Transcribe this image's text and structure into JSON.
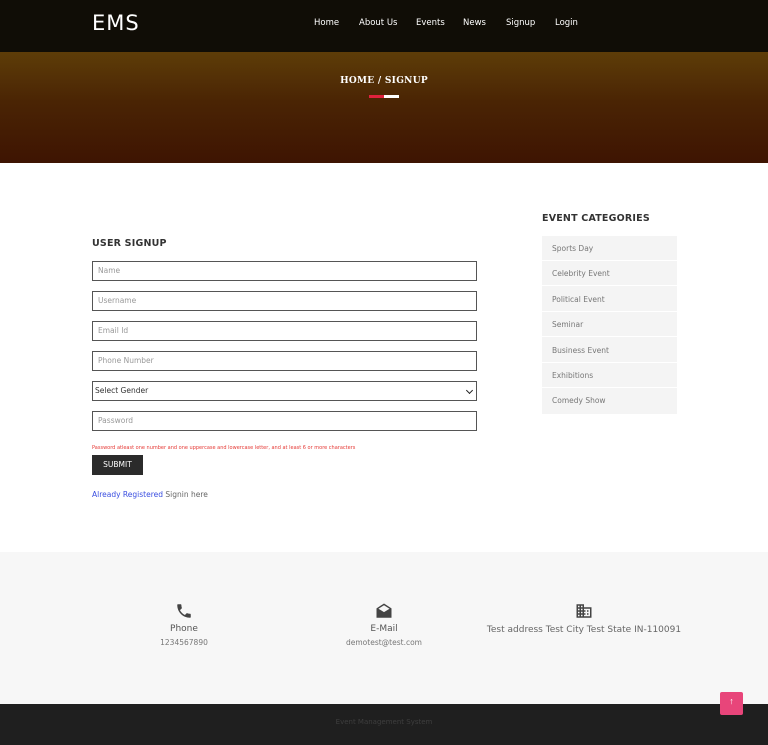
{
  "header": {
    "brand": "EMS",
    "nav": [
      "Home",
      "About Us",
      "Events",
      "News",
      "Signup",
      "Login"
    ]
  },
  "banner": {
    "breadcrumb": "HOME / SIGNUP"
  },
  "form": {
    "title": "USER SIGNUP",
    "fields": {
      "name": "Name",
      "username": "Username",
      "email": "Email Id",
      "phone": "Phone Number",
      "gender": "Select Gender",
      "password": "Password"
    },
    "password_hint": "Password atleast one number and one uppercase and lowercase letter, and at least 6 or more characters",
    "submit_label": "SUBMIT",
    "already_registered": "Already Registered",
    "signin_here": "Signin here"
  },
  "categories": {
    "title": "EVENT CATEGORIES",
    "items": [
      "Sports Day",
      "Celebrity Event",
      "Political Event",
      "Seminar",
      "Business Event",
      "Exhibitions",
      "Comedy Show"
    ]
  },
  "contact": {
    "phone": {
      "label": "Phone",
      "value": "1234567890"
    },
    "email": {
      "label": "E-Mail",
      "value": "demotest@test.com"
    },
    "address": {
      "value": "Test address Test City Test State IN-110091"
    }
  },
  "footer": {
    "text": "Event Management System"
  },
  "colors": {
    "accent_red": "#e0223d",
    "link_blue": "#3a4ee0",
    "scroll_top_pink": "#e8457a"
  },
  "icons": {
    "phone": "phone-icon",
    "email": "envelope-open-icon",
    "address": "building-icon",
    "scroll_top": "arrow-up-icon"
  }
}
